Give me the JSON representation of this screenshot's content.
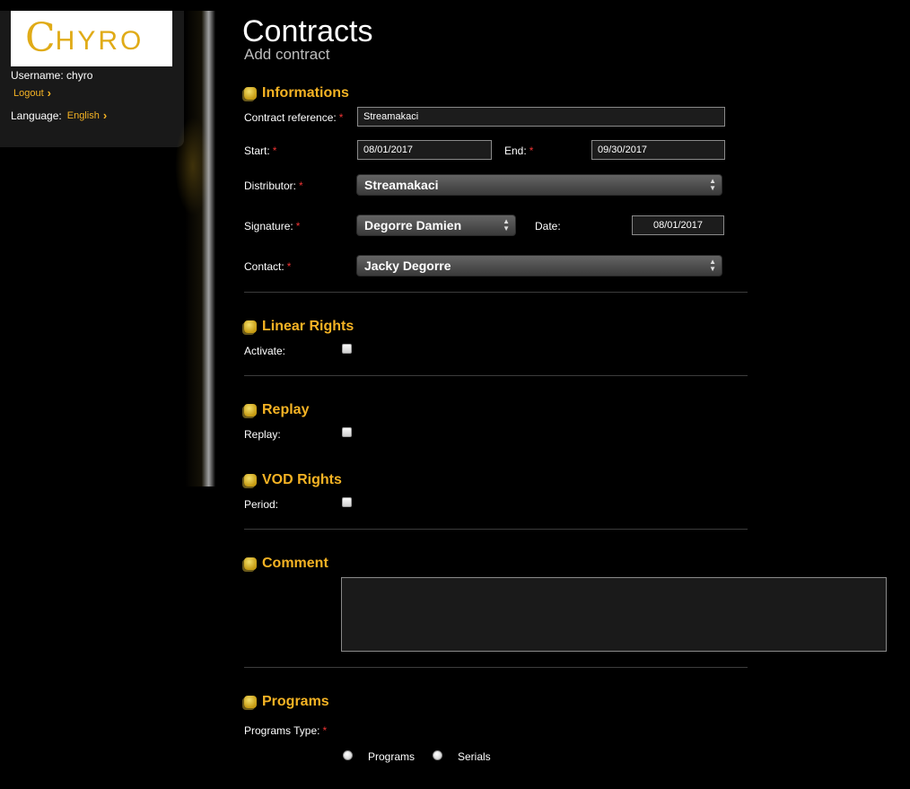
{
  "sidebar": {
    "logo_initial": "C",
    "logo_rest": "HYRO",
    "username_label": "Username:",
    "username": "chyro",
    "logout_label": "Logout",
    "language_label": "Language:",
    "language_value": "English"
  },
  "header": {
    "title": "Contracts",
    "subtitle": "Add contract"
  },
  "informations": {
    "title": "Informations",
    "contract_reference_label": "Contract reference:",
    "contract_reference_value": "Streamakaci",
    "start_label": "Start:",
    "start_value": "08/01/2017",
    "end_label": "End:",
    "end_value": "09/30/2017",
    "distributor_label": "Distributor:",
    "distributor_value": "Streamakaci",
    "signature_label": "Signature:",
    "signature_value": "Degorre Damien",
    "date_label": "Date:",
    "date_value": "08/01/2017",
    "contact_label": "Contact:",
    "contact_value": "Jacky Degorre",
    "required_mark": "*"
  },
  "linear_rights": {
    "title": "Linear Rights",
    "activate_label": "Activate:",
    "checked": false
  },
  "replay": {
    "title": "Replay",
    "replay_label": "Replay:",
    "checked": false
  },
  "vod_rights": {
    "title": "VOD Rights",
    "period_label": "Period:",
    "checked": false
  },
  "comment": {
    "title": "Comment",
    "value": ""
  },
  "programs": {
    "title": "Programs",
    "type_label": "Programs Type:",
    "options": [
      "Programs",
      "Serials"
    ]
  },
  "colors": {
    "accent": "#f5b324",
    "required": "#e33333",
    "background": "#000000"
  }
}
